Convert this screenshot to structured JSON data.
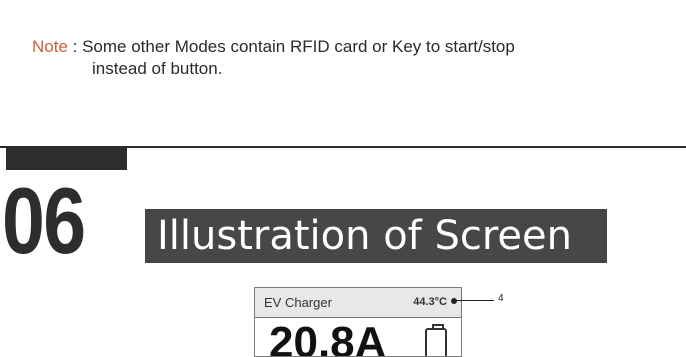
{
  "note": {
    "label": "Note",
    "sep": " : ",
    "line1": "Some other Modes contain RFID card or Key to start/stop",
    "line2": "instead of button."
  },
  "section": {
    "number": "06",
    "title": "Illustration of Screen"
  },
  "screen": {
    "title": "EV Charger",
    "temperature": "44.3°C",
    "current": "20.8A"
  },
  "callout": {
    "number": "4"
  },
  "colors": {
    "note_label": "#c8613a",
    "dark": "#2d2d2d",
    "title_bg": "#474747"
  }
}
